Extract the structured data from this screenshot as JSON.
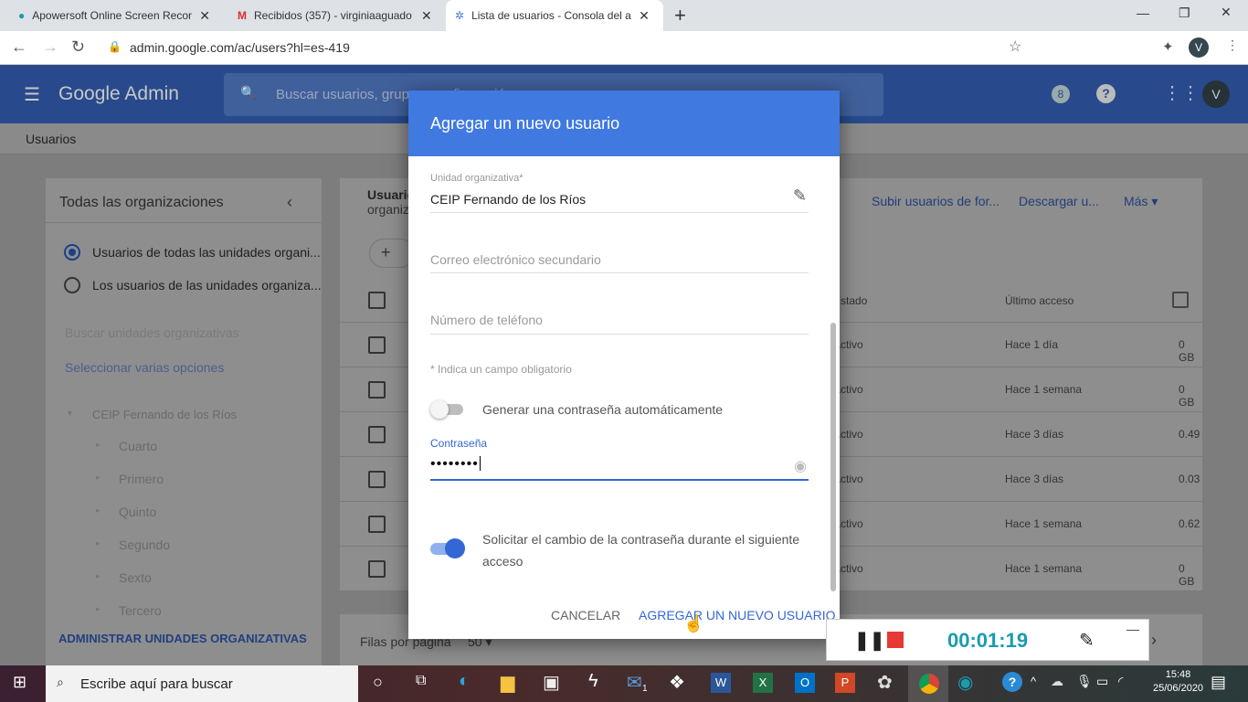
{
  "browser": {
    "tabs": [
      {
        "title": "Apowersoft Online Screen Recor",
        "icon": "apowersoft-icon"
      },
      {
        "title": "Recibidos (357) - virginiaaguado",
        "icon": "gmail-icon"
      },
      {
        "title": "Lista de usuarios - Consola del ad",
        "icon": "admin-icon"
      }
    ],
    "url": "admin.google.com/ac/users?hl=es-419",
    "profile": "V",
    "window_controls": {
      "minimize": "—",
      "restore": "❐",
      "close": "✕"
    }
  },
  "header": {
    "logo": "Google Admin",
    "search_placeholder": "Buscar usuarios, grupos, configuración",
    "notif": "8",
    "avatar": "V"
  },
  "breadcrumb": "Usuarios",
  "left_panel": {
    "title": "Todas las organizaciones",
    "radios": [
      "Usuarios de todas las unidades organi...",
      "Los usuarios de las unidades organiza..."
    ],
    "search_placeholder": "Buscar unidades organizativas",
    "select_multi": "Seleccionar varias opciones",
    "tree_root": "CEIP Fernando de los Ríos",
    "tree_children": [
      "Cuarto",
      "Primero",
      "Quinto",
      "Segundo",
      "Sexto",
      "Tercero"
    ],
    "manage": "ADMINISTRAR UNIDADES ORGANIZATIVAS"
  },
  "users_panel": {
    "title": "Usuarios",
    "subtitle": "organiz",
    "actions": [
      "Subir usuarios de for...",
      "Descargar u...",
      "Más"
    ],
    "columns": {
      "status": "Estado",
      "last": "Último acceso"
    },
    "rows": [
      {
        "status": "Activo",
        "last": "Hace 1 día",
        "storage": "0 GB"
      },
      {
        "status": "Activo",
        "last": "Hace 1 semana",
        "storage": "0 GB"
      },
      {
        "status": "Activo",
        "last": "Hace 3 días",
        "storage": "0.49"
      },
      {
        "status": "Activo",
        "last": "Hace 3 días",
        "storage": "0.03"
      },
      {
        "status": "Activo",
        "last": "Hace 1 semana",
        "storage": "0.62"
      },
      {
        "status": "Activo",
        "last": "Hace 1 semana",
        "storage": "0 GB"
      }
    ],
    "rows_per_page_label": "Filas por página",
    "rows_per_page": "50"
  },
  "dialog": {
    "title": "Agregar un nuevo usuario",
    "org_label": "Unidad organizativa*",
    "org_value": "CEIP Fernando de los Ríos",
    "secondary_email_placeholder": "Correo electrónico secundario",
    "phone_placeholder": "Número de teléfono",
    "required_note": "* Indica un campo obligatorio",
    "auto_password_label": "Generar una contraseña automáticamente",
    "auto_password_on": false,
    "password_label": "Contraseña",
    "password_value": "••••••••",
    "change_password_label": "Solicitar el cambio de la contraseña durante el siguiente acceso",
    "change_password_on": true,
    "cancel": "CANCELAR",
    "submit": "AGREGAR UN NUEVO USUARIO"
  },
  "recorder": {
    "time": "00:01:19",
    "minimize": "—"
  },
  "taskbar": {
    "search_placeholder": "Escribe aquí para buscar",
    "time": "15:48",
    "date": "25/06/2020",
    "mail_badge": "1"
  },
  "colors": {
    "accent": "#4079e0",
    "header": "#284a8c",
    "record": "#e53935",
    "timer": "#1a9bb0"
  }
}
